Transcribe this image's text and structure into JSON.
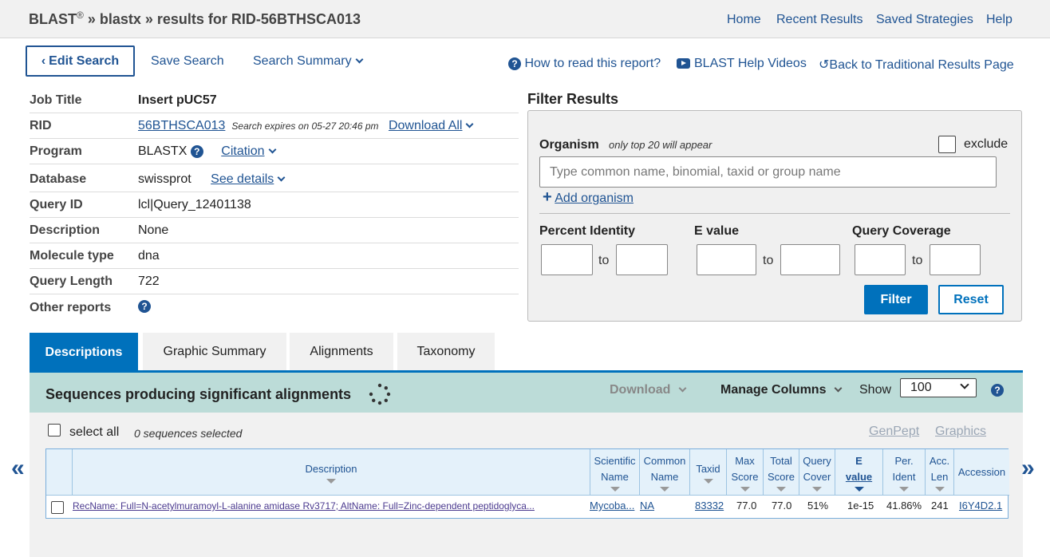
{
  "header": {
    "blast": "BLAST",
    "reg": "®",
    "crumb_rest": "» blastx » results for RID-56BTHSCA013",
    "nav": [
      "Home",
      "Recent Results",
      "Saved Strategies",
      "Help"
    ]
  },
  "toolbar": {
    "edit_search": "Edit Search",
    "save_search": "Save Search",
    "search_summary": "Search Summary",
    "how_to_read": "How to read this report?",
    "help_videos": "BLAST Help Videos",
    "back_traditional": "Back to Traditional Results Page"
  },
  "job": {
    "job_title_label": "Job Title",
    "job_title": "Insert pUC57",
    "rid_label": "RID",
    "rid": "56BTHSCA013",
    "expires": "Search expires on 05-27 20:46 pm",
    "download_all": "Download All",
    "program_label": "Program",
    "program": "BLASTX",
    "citation": "Citation",
    "database_label": "Database",
    "database": "swissprot",
    "see_details": "See details",
    "query_id_label": "Query ID",
    "query_id": "lcl|Query_12401138",
    "description_label": "Description",
    "description": "None",
    "molecule_type_label": "Molecule type",
    "molecule_type": "dna",
    "query_length_label": "Query Length",
    "query_length": "722",
    "other_reports_label": "Other reports"
  },
  "filter": {
    "title": "Filter Results",
    "organism_label": "Organism",
    "organism_note": "only top 20 will appear",
    "exclude": "exclude",
    "organism_placeholder": "Type common  name, binomial, taxid or group  name",
    "add_organism": "Add organism",
    "percent_identity": "Percent Identity",
    "e_value": "E value",
    "query_coverage": "Query Coverage",
    "to": "to",
    "filter_btn": "Filter",
    "reset_btn": "Reset"
  },
  "tabs": [
    "Descriptions",
    "Graphic Summary",
    "Alignments",
    "Taxonomy"
  ],
  "results": {
    "title": "Sequences producing significant alignments",
    "download": "Download",
    "manage_columns": "Manage Columns",
    "show": "Show",
    "show_value": "100",
    "select_all": "select all",
    "selected_count": "0 sequences selected",
    "genpept": "GenPept",
    "graphics": "Graphics"
  },
  "table": {
    "headers": {
      "description": "Description",
      "scientific_name": [
        "Scientific",
        "Name"
      ],
      "common_name": [
        "Common",
        "Name"
      ],
      "taxid": "Taxid",
      "max_score": [
        "Max",
        "Score"
      ],
      "total_score": [
        "Total",
        "Score"
      ],
      "query_cover": [
        "Query",
        "Cover"
      ],
      "e_value": [
        "E",
        "value"
      ],
      "per_ident": [
        "Per.",
        "Ident"
      ],
      "acc_len": [
        "Acc.",
        "Len"
      ],
      "accession": "Accession"
    },
    "rows": [
      {
        "description": "RecName: Full=N-acetylmuramoyl-L-alanine amidase Rv3717; AltName: Full=Zinc-dependent peptidoglyca...",
        "scientific_name": "Mycoba...",
        "common_name": "NA",
        "taxid": "83332",
        "max_score": "77.0",
        "total_score": "77.0",
        "query_cover": "51%",
        "e_value": "1e-15",
        "per_ident": "41.86%",
        "acc_len": "241",
        "accession": "I6Y4D2.1"
      }
    ]
  },
  "pager": {
    "prev": "«",
    "next": "»"
  }
}
